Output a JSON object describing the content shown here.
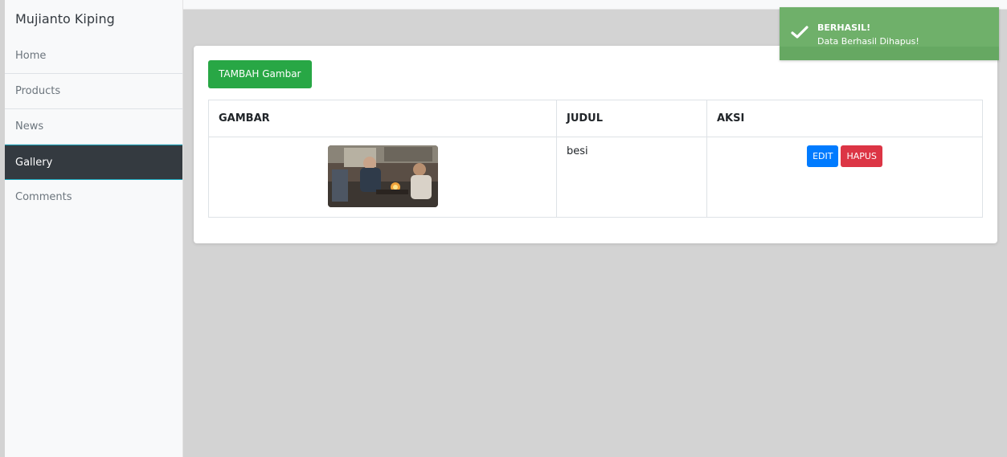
{
  "sidebar": {
    "brand": "Mujianto Kiping",
    "items": [
      {
        "label": "Home"
      },
      {
        "label": "Products"
      },
      {
        "label": "News"
      },
      {
        "label": "Gallery",
        "active": true
      },
      {
        "label": "Comments"
      }
    ]
  },
  "main": {
    "add_button_label": "TAMBAH Gambar",
    "table": {
      "headers": [
        "GAMBAR",
        "JUDUL",
        "AKSI"
      ],
      "rows": [
        {
          "image_icon": "workshop-photo",
          "judul": "besi",
          "edit_label": "EDIT",
          "hapus_label": "HAPUS"
        }
      ]
    }
  },
  "toast": {
    "title": "BERHASIL!",
    "message": "Data Berhasil Dihapus!",
    "icon": "check-icon",
    "color": "#6fb06a"
  },
  "colors": {
    "sidebar_active_bg": "#343a40",
    "accent_add": "#28a745",
    "edit": "#007bff",
    "hapus": "#dc3545"
  }
}
